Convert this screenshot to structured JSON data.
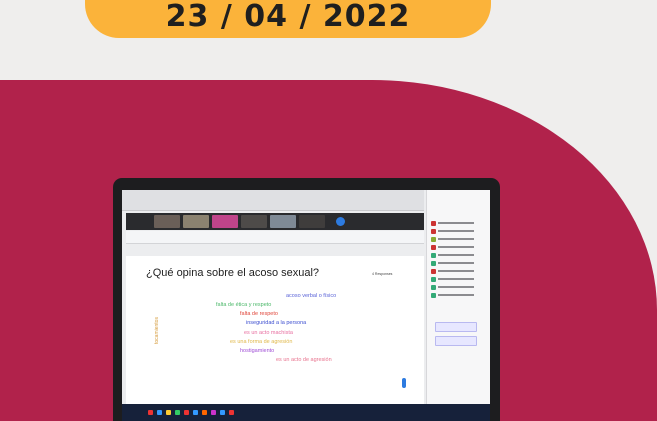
{
  "banner": {
    "date": "23 / 04 / 2022"
  },
  "slide": {
    "question": "¿Qué opina sobre el acoso sexual?",
    "responses_label": "4 Responses",
    "vertical_word": "tocamientos",
    "words": [
      {
        "text": "acoso verbal o físico",
        "color": "#5a63d8"
      },
      {
        "text": "falta de ética y respeto",
        "color": "#4cb86a"
      },
      {
        "text": "falta de respeto",
        "color": "#e0463a"
      },
      {
        "text": "inseguridad a la persona",
        "color": "#3d4fd0"
      },
      {
        "text": "es un acto machista",
        "color": "#e86fa0"
      },
      {
        "text": "es una forma de agresión",
        "color": "#e0b84a"
      },
      {
        "text": "hostigamiento",
        "color": "#a04fd6"
      },
      {
        "text": "es un acto de agresión",
        "color": "#e8738e"
      }
    ]
  },
  "colors": {
    "background": "#efeeed",
    "badge": "#fbb33a",
    "crimson": "#b1224b"
  }
}
